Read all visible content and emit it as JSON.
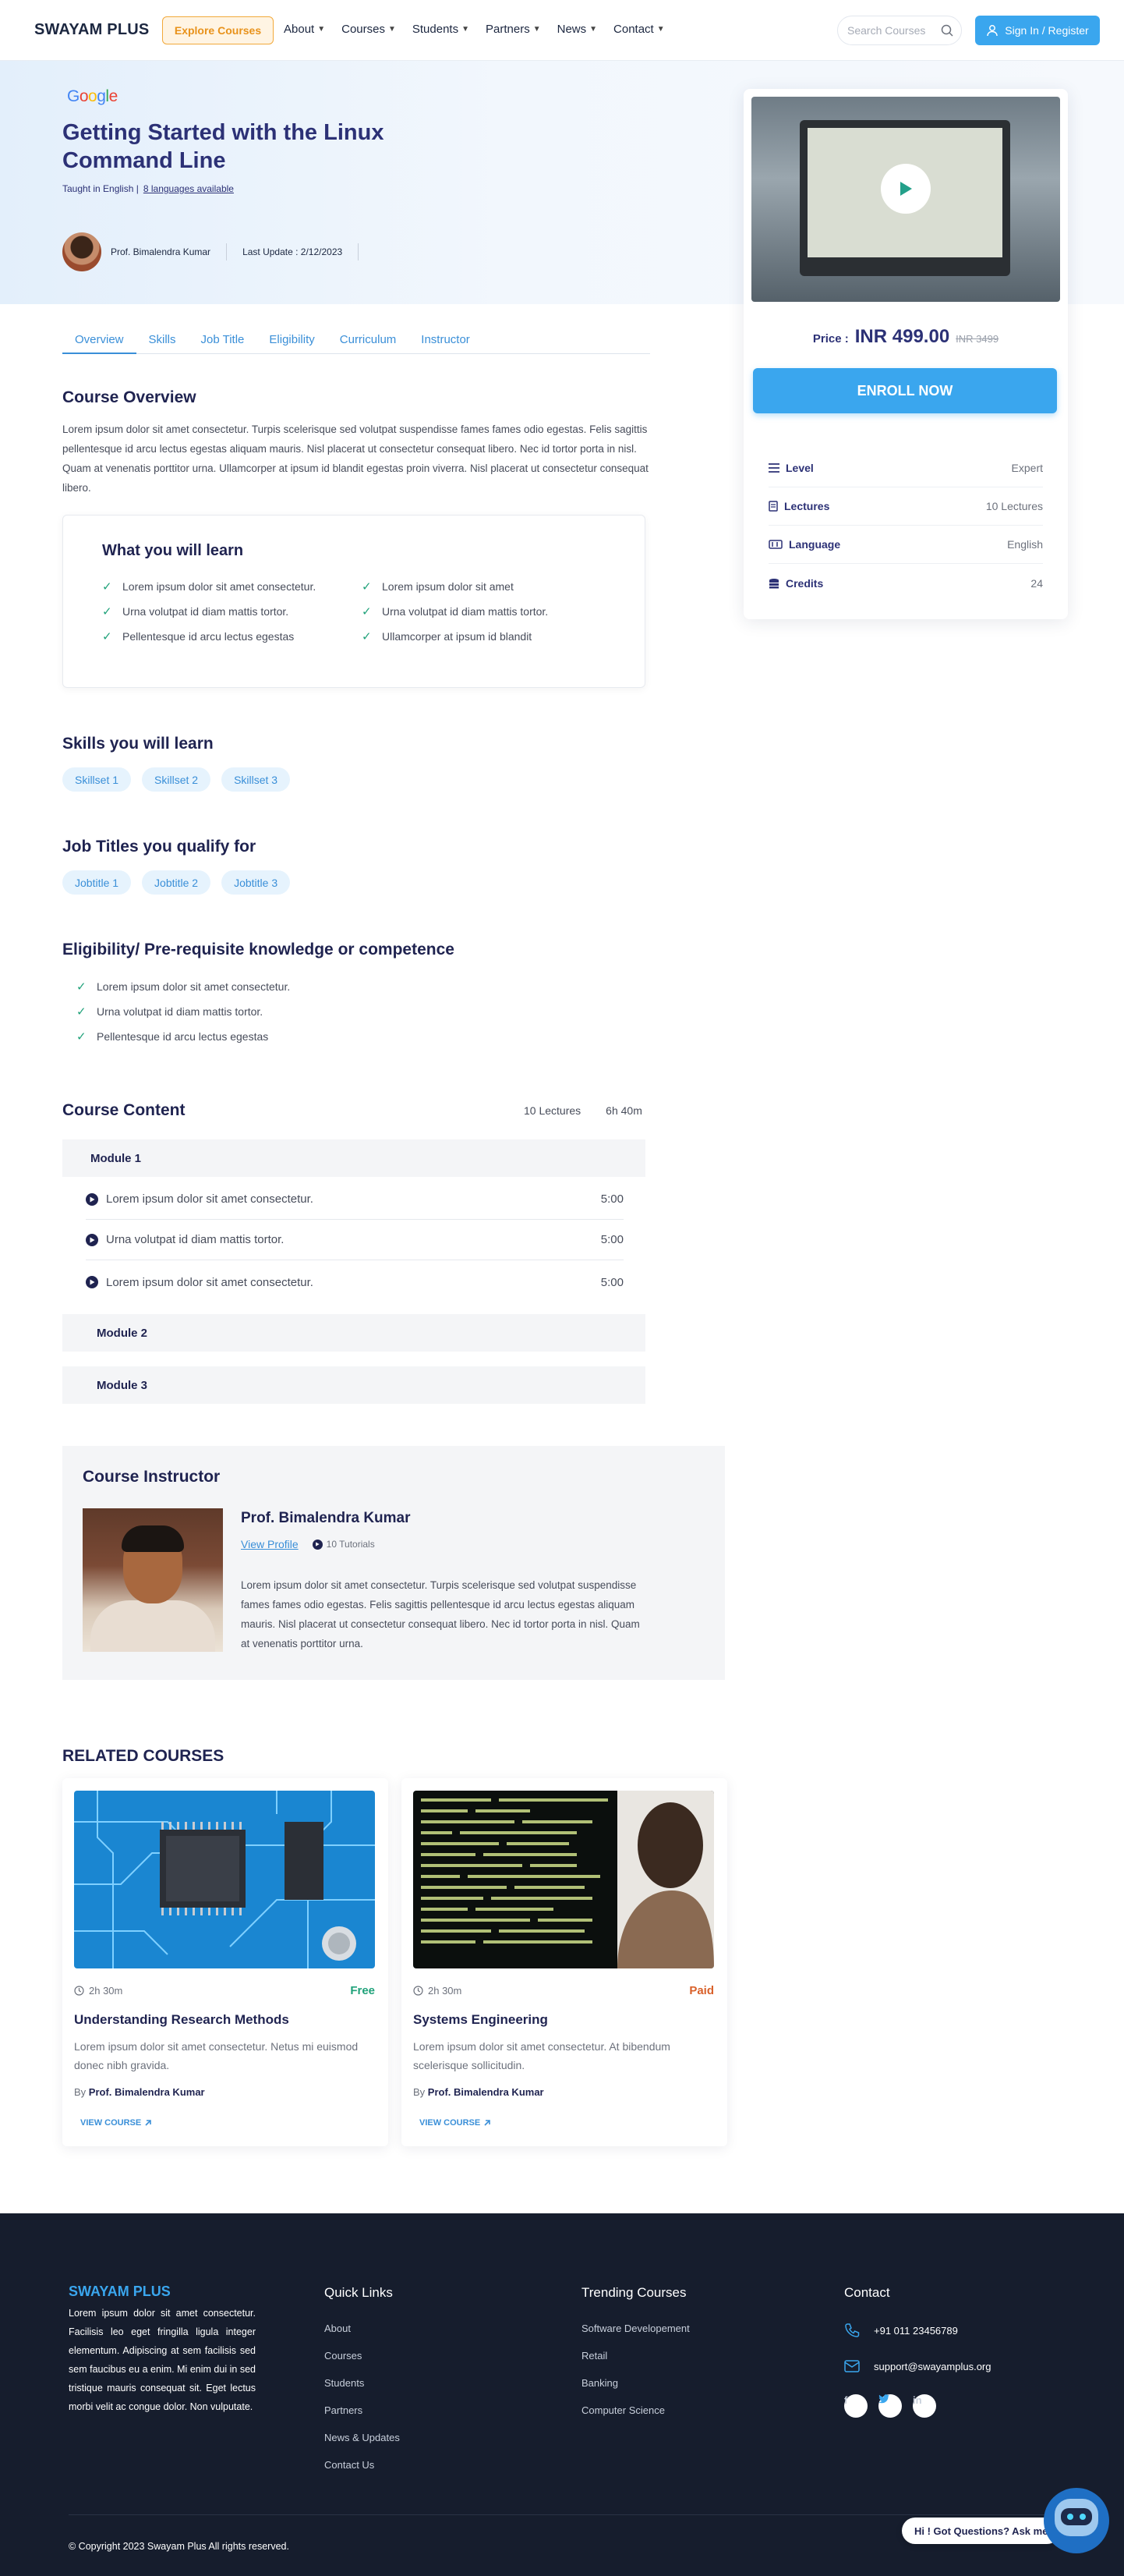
{
  "header": {
    "logo": "SWAYAM PLUS",
    "explore_label": "Explore Courses",
    "nav": [
      "About",
      "Courses",
      "Students",
      "Partners",
      "News",
      "Contact"
    ],
    "search_placeholder": "Search Courses",
    "signin_label": "Sign In / Register"
  },
  "hero": {
    "provider": "Google",
    "title": "Getting Started with the Linux Command Line",
    "taught": "Taught in English |",
    "languages_link": "8 languages available",
    "instructor": "Prof. Bimalendra Kumar",
    "last_update": "Last Update : 2/12/2023"
  },
  "pricing": {
    "label": "Price :",
    "amount": "INR 499.00",
    "old": "INR 3499",
    "enroll": "ENROLL NOW",
    "specs": [
      {
        "key": "Level",
        "value": "Expert",
        "icon": "level-icon"
      },
      {
        "key": "Lectures",
        "value": "10 Lectures",
        "icon": "document-icon"
      },
      {
        "key": "Language",
        "value": "English",
        "icon": "language-icon"
      },
      {
        "key": "Credits",
        "value": "24",
        "icon": "coins-icon"
      }
    ]
  },
  "tabs": [
    "Overview",
    "Skills",
    "Job Title",
    "Eligibility",
    "Curriculum",
    "Instructor"
  ],
  "overview": {
    "heading": "Course Overview",
    "text": "Lorem ipsum dolor sit amet consectetur. Turpis scelerisque sed volutpat suspendisse fames fames odio egestas. Felis sagittis pellentesque id arcu lectus egestas aliquam mauris. Nisl placerat ut consectetur consequat libero. Nec id tortor porta in nisl. Quam at venenatis porttitor urna. Ullamcorper at ipsum id blandit egestas proin viverra. Nisl placerat ut consectetur consequat libero."
  },
  "learn": {
    "heading": "What you will learn",
    "items": [
      "Lorem ipsum dolor sit amet consectetur.",
      "Lorem ipsum dolor sit amet",
      "Urna volutpat id diam mattis tortor.",
      "Urna volutpat id diam mattis tortor.",
      "Pellentesque id arcu lectus egestas",
      "Ullamcorper at ipsum id blandit"
    ]
  },
  "skills": {
    "heading": "Skills you will learn",
    "items": [
      "Skillset 1",
      "Skillset 2",
      "Skillset 3"
    ]
  },
  "jobs": {
    "heading": "Job Titles you qualify for",
    "items": [
      "Jobtitle 1",
      "Jobtitle 2",
      "Jobtitle 3"
    ]
  },
  "eligibility": {
    "heading": "Eligibility/ Pre-requisite knowledge or competence",
    "items": [
      "Lorem ipsum dolor sit amet consectetur.",
      "Urna volutpat id diam mattis tortor.",
      "Pellentesque id arcu lectus egestas"
    ]
  },
  "content": {
    "heading": "Course Content",
    "lectures": "10 Lectures",
    "duration": "6h 40m",
    "modules": [
      "Module 1",
      "Module 2",
      "Module 3"
    ],
    "lessons": [
      {
        "title": "Lorem ipsum dolor sit amet consectetur.",
        "time": "5:00"
      },
      {
        "title": "Urna volutpat id diam mattis tortor.",
        "time": "5:00"
      },
      {
        "title": "Lorem ipsum dolor sit amet consectetur.",
        "time": "5:00"
      }
    ]
  },
  "instructor": {
    "heading": "Course Instructor",
    "name": "Prof. Bimalendra Kumar",
    "profile_link": "View Profile",
    "tutorials": "10 Tutorials",
    "bio": "Lorem ipsum dolor sit amet consectetur. Turpis scelerisque sed volutpat suspendisse fames fames odio egestas. Felis sagittis pellentesque id arcu lectus egestas aliquam mauris. Nisl placerat ut consectetur consequat libero. Nec id tortor porta in nisl. Quam at venenatis porttitor urna."
  },
  "related": {
    "heading": "RELATED COURSES",
    "courses": [
      {
        "duration": "2h 30m",
        "badge": "Free",
        "title": "Understanding Research Methods",
        "desc": "Lorem ipsum dolor sit amet consectetur. Netus mi euismod donec nibh gravida.",
        "by": "By",
        "author": "Prof. Bimalendra Kumar",
        "cta": "VIEW COURSE"
      },
      {
        "duration": "2h 30m",
        "badge": "Paid",
        "title": "Systems Engineering",
        "desc": "Lorem ipsum dolor sit amet consectetur. At bibendum scelerisque sollicitudin.",
        "by": "By",
        "author": "Prof. Bimalendra Kumar",
        "cta": "VIEW COURSE"
      }
    ]
  },
  "footer": {
    "logo": "SWAYAM PLUS",
    "desc": "Lorem ipsum dolor sit amet consectetur. Facilisis leo eget fringilla ligula integer elementum. Adipiscing at sem facilisis sed sem faucibus eu a enim. Mi enim dui in sed tristique mauris consequat sit. Eget lectus morbi velit ac congue dolor. Non vulputate.",
    "quick_heading": "Quick Links",
    "quick": [
      "About",
      "Courses",
      "Students",
      "Partners",
      "News & Updates",
      "Contact Us"
    ],
    "trending_heading": "Trending Courses",
    "trending": [
      "Software Developement",
      "Retail",
      "Banking",
      "Computer Science"
    ],
    "contact_heading": "Contact",
    "phone": "+91 011 23456789",
    "email": "support@swayamplus.org",
    "socials": [
      "f",
      "t",
      "in"
    ],
    "copyright": "© Copyright 2023  Swayam Plus  All rights reserved.",
    "chat": "Hi ! Got Questions? Ask me"
  }
}
